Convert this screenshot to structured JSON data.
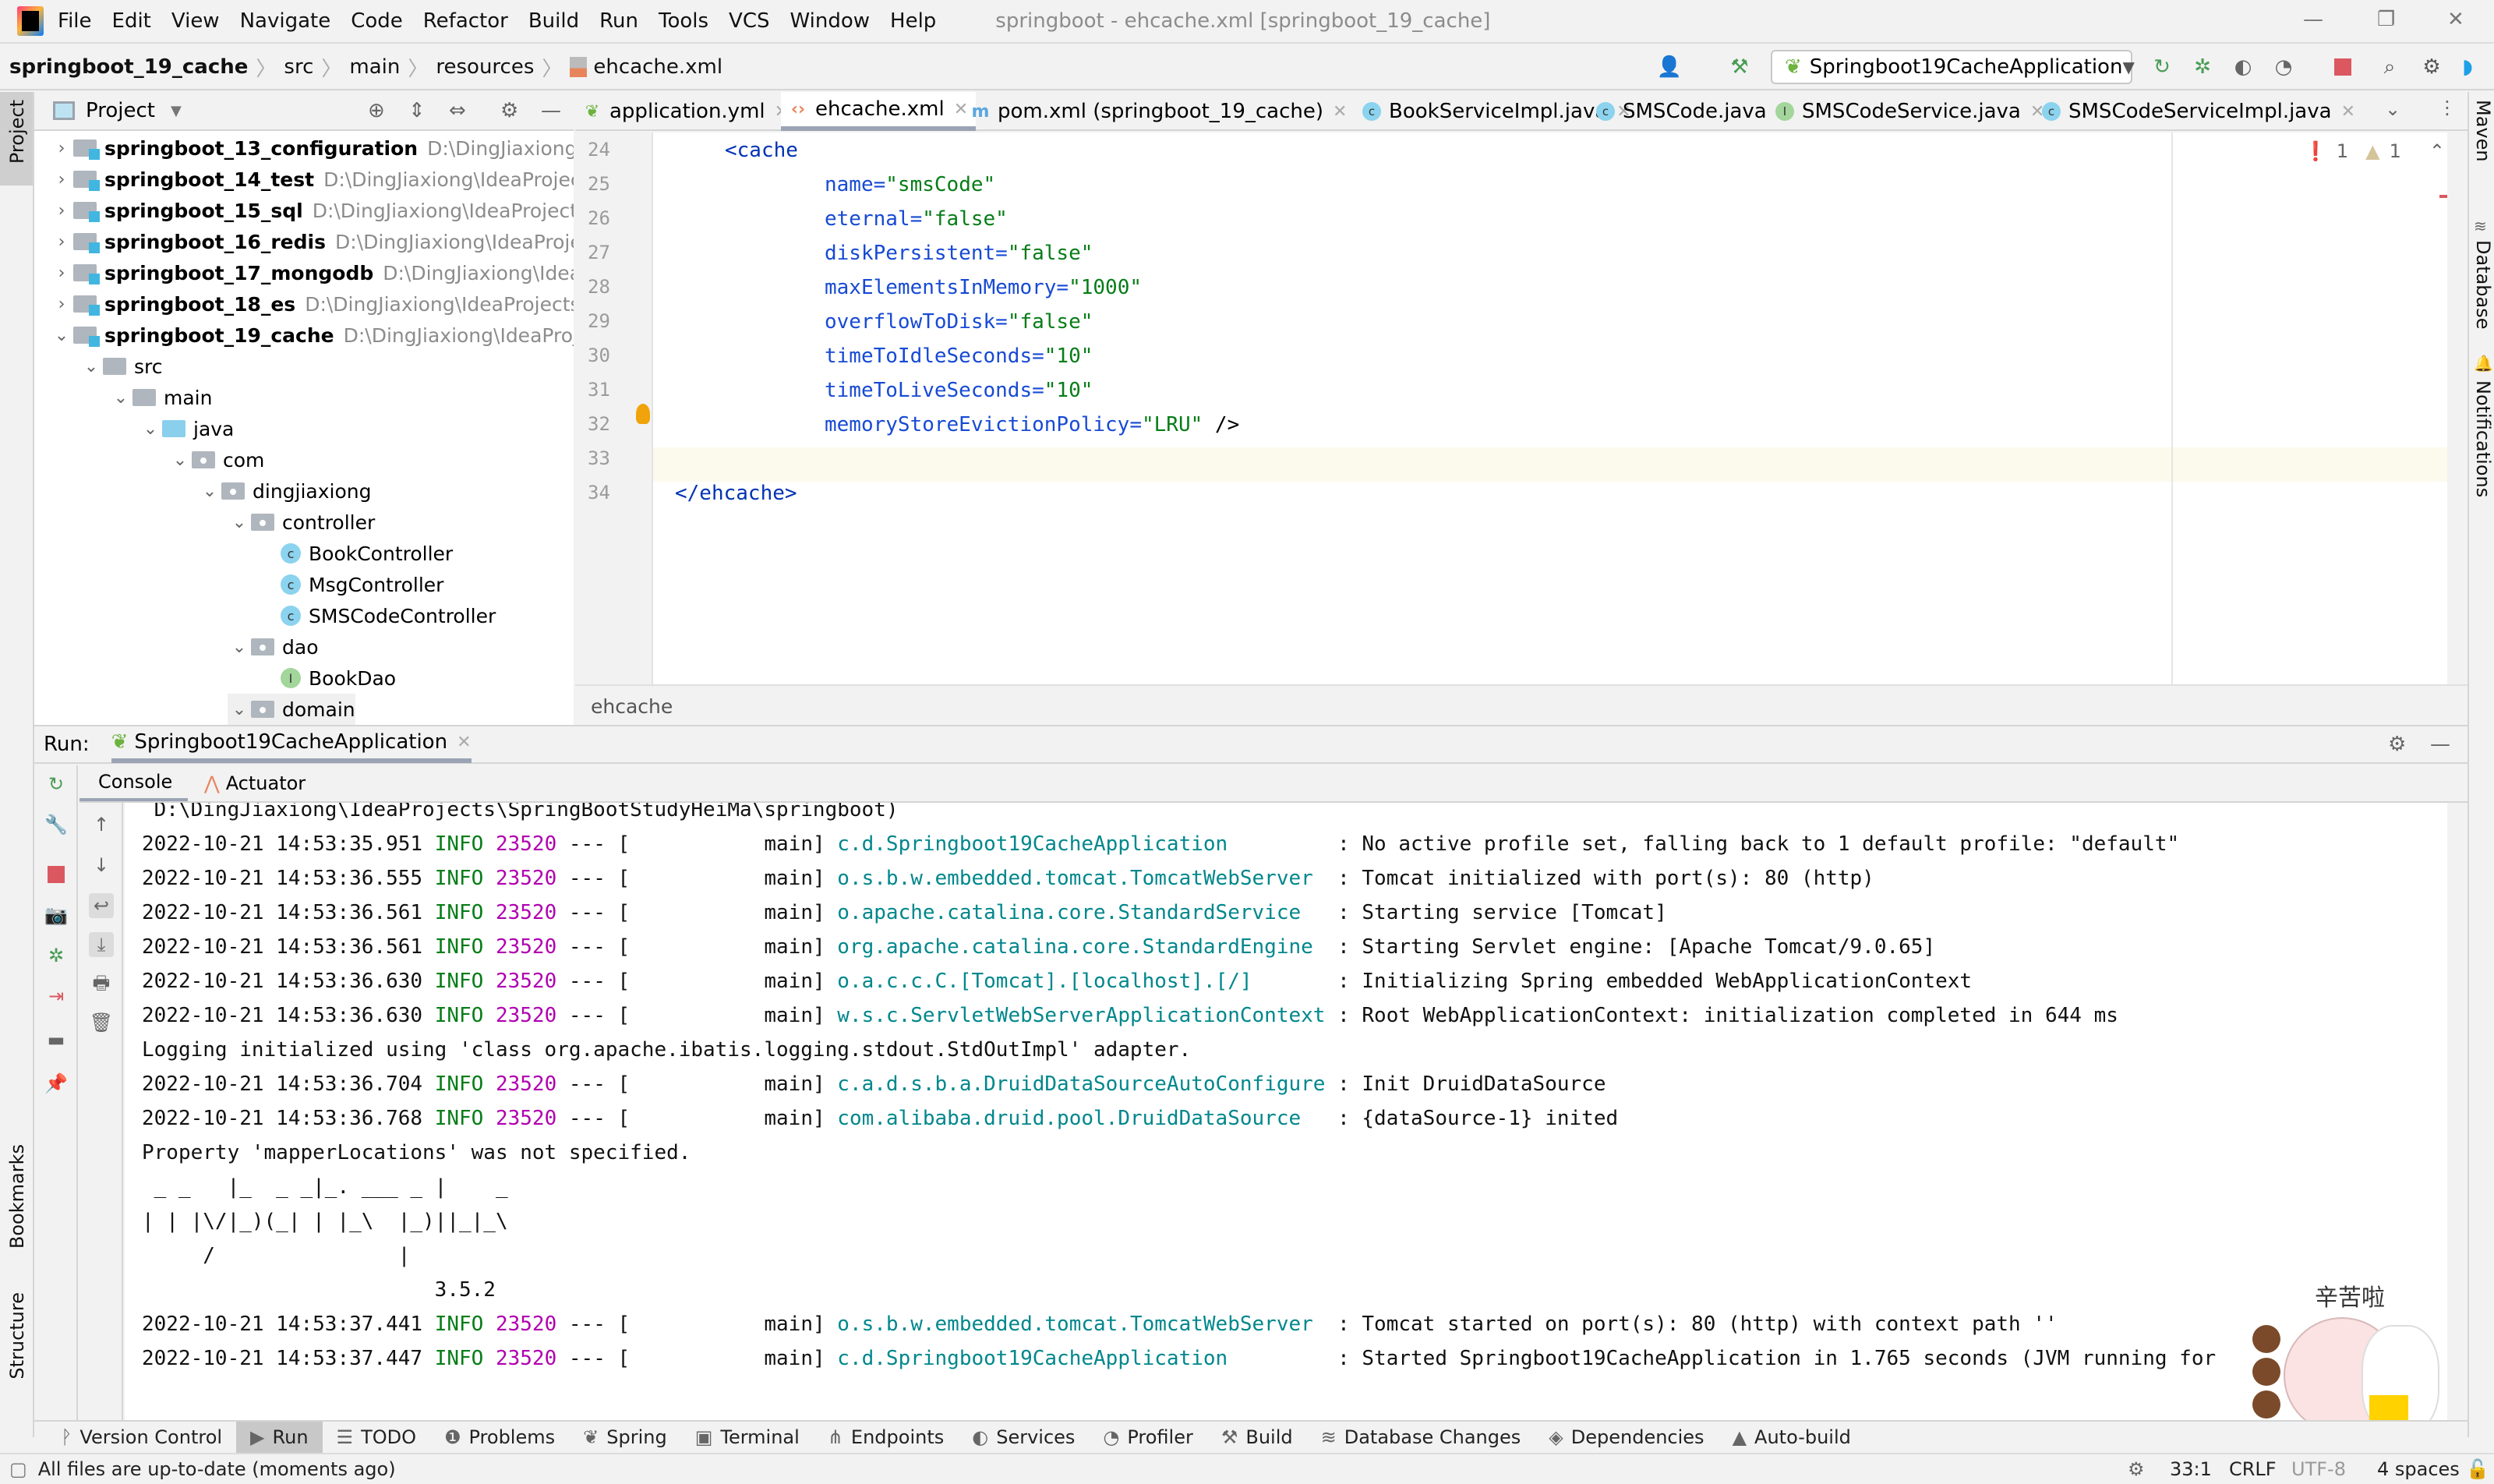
{
  "menubar": {
    "items": [
      "File",
      "Edit",
      "View",
      "Navigate",
      "Code",
      "Refactor",
      "Build",
      "Run",
      "Tools",
      "VCS",
      "Window",
      "Help"
    ],
    "window_title": "springboot - ehcache.xml [springboot_19_cache]",
    "window_controls": [
      "minimize",
      "restore",
      "close"
    ]
  },
  "navbar": {
    "breadcrumbs": [
      "springboot_19_cache",
      "src",
      "main",
      "resources",
      "ehcache.xml"
    ],
    "run_config": "Springboot19CacheApplication"
  },
  "project_panel": {
    "title": "Project",
    "tree": [
      {
        "label": "springboot_13_configuration",
        "path": "D:\\DingJiaxiong\\IdeaProjects\\SpringBootStudyHeiMa",
        "type": "module",
        "expanded": false,
        "depth": 0
      },
      {
        "label": "springboot_14_test",
        "path": "D:\\DingJiaxiong\\IdeaProjects\\SpringBootStudyHeiMa",
        "type": "module",
        "expanded": false,
        "depth": 0
      },
      {
        "label": "springboot_15_sql",
        "path": "D:\\DingJiaxiong\\IdeaProjects\\SpringBootStudyHeiMa",
        "type": "module",
        "expanded": false,
        "depth": 0
      },
      {
        "label": "springboot_16_redis",
        "path": "D:\\DingJiaxiong\\IdeaProjects\\SpringBootStudyHeiMa",
        "type": "module",
        "expanded": false,
        "depth": 0
      },
      {
        "label": "springboot_17_mongodb",
        "path": "D:\\DingJiaxiong\\IdeaProjects\\SpringBootStudyHeiMa",
        "type": "module",
        "expanded": false,
        "depth": 0
      },
      {
        "label": "springboot_18_es",
        "path": "D:\\DingJiaxiong\\IdeaProjects\\SpringBootStudyHeiMa",
        "type": "module",
        "expanded": false,
        "depth": 0
      },
      {
        "label": "springboot_19_cache",
        "path": "D:\\DingJiaxiong\\IdeaProjects\\SpringBootStudyHeiMa",
        "type": "module",
        "expanded": true,
        "depth": 0
      },
      {
        "label": "src",
        "type": "folder",
        "expanded": true,
        "depth": 1
      },
      {
        "label": "main",
        "type": "folder",
        "expanded": true,
        "depth": 2
      },
      {
        "label": "java",
        "type": "source",
        "expanded": true,
        "depth": 3
      },
      {
        "label": "com",
        "type": "package",
        "expanded": true,
        "depth": 4
      },
      {
        "label": "dingjiaxiong",
        "type": "package",
        "expanded": true,
        "depth": 5
      },
      {
        "label": "controller",
        "type": "package",
        "expanded": true,
        "depth": 6
      },
      {
        "label": "BookController",
        "type": "class",
        "depth": 7
      },
      {
        "label": "MsgController",
        "type": "class",
        "depth": 7
      },
      {
        "label": "SMSCodeController",
        "type": "class",
        "depth": 7
      },
      {
        "label": "dao",
        "type": "package",
        "expanded": true,
        "depth": 6
      },
      {
        "label": "BookDao",
        "type": "interface",
        "depth": 7
      },
      {
        "label": "domain",
        "type": "package",
        "expanded": true,
        "depth": 6
      }
    ]
  },
  "editor_tabs": [
    {
      "label": "application.yml",
      "icon": "spring-icon"
    },
    {
      "label": "ehcache.xml",
      "icon": "xml-icon",
      "active": true
    },
    {
      "label": "pom.xml (springboot_19_cache)",
      "icon": "maven-icon"
    },
    {
      "label": "BookServiceImpl.java",
      "icon": "class-icon"
    },
    {
      "label": "SMSCode.java",
      "icon": "class-icon"
    },
    {
      "label": "SMSCodeService.java",
      "icon": "interface-icon"
    },
    {
      "label": "SMSCodeServiceImpl.java",
      "icon": "class-icon"
    }
  ],
  "editor": {
    "inspections": {
      "errors": "1",
      "warnings": "1"
    },
    "lines": [
      {
        "n": "24",
        "tag": "<cache"
      },
      {
        "n": "25",
        "attr": "name=",
        "val": "\"smsCode\""
      },
      {
        "n": "26",
        "attr": "eternal=",
        "val": "\"false\""
      },
      {
        "n": "27",
        "attr": "diskPersistent=",
        "val": "\"false\""
      },
      {
        "n": "28",
        "attr": "maxElementsInMemory=",
        "val": "\"1000\""
      },
      {
        "n": "29",
        "attr": "overflowToDisk=",
        "val": "\"false\""
      },
      {
        "n": "30",
        "attr": "timeToIdleSeconds=",
        "val": "\"10\""
      },
      {
        "n": "31",
        "attr": "timeToLiveSeconds=",
        "val": "\"10\""
      },
      {
        "n": "32",
        "attr": "memoryStoreEvictionPolicy=",
        "val": "\"LRU\"",
        "tail": " />"
      },
      {
        "n": "33"
      },
      {
        "n": "34",
        "close": "</ehcache>"
      }
    ],
    "footer_breadcrumb": "ehcache"
  },
  "right_strip": [
    "Maven",
    "Database",
    "Notifications"
  ],
  "left_strip": [
    "Project",
    "Bookmarks",
    "Structure"
  ],
  "run_panel": {
    "label": "Run:",
    "config_tab": "Springboot19CacheApplication",
    "subtabs": [
      "Console",
      "Actuator"
    ],
    "console": {
      "first_line": " D:\\DingJiaxiong\\IdeaProjects\\SpringBootStudyHeiMa\\springboot)",
      "logs": [
        {
          "ts": "2022-10-21 14:53:35.951",
          "level": "INFO",
          "pid": "23520",
          "thread": "--- [           main]",
          "logger": "c.d.Springboot19CacheApplication        ",
          "msg": ": No active profile set, falling back to 1 default profile: \"default\""
        },
        {
          "ts": "2022-10-21 14:53:36.555",
          "level": "INFO",
          "pid": "23520",
          "thread": "--- [           main]",
          "logger": "o.s.b.w.embedded.tomcat.TomcatWebServer ",
          "msg": ": Tomcat initialized with port(s): 80 (http)"
        },
        {
          "ts": "2022-10-21 14:53:36.561",
          "level": "INFO",
          "pid": "23520",
          "thread": "--- [           main]",
          "logger": "o.apache.catalina.core.StandardService  ",
          "msg": ": Starting service [Tomcat]"
        },
        {
          "ts": "2022-10-21 14:53:36.561",
          "level": "INFO",
          "pid": "23520",
          "thread": "--- [           main]",
          "logger": "org.apache.catalina.core.StandardEngine ",
          "msg": ": Starting Servlet engine: [Apache Tomcat/9.0.65]"
        },
        {
          "ts": "2022-10-21 14:53:36.630",
          "level": "INFO",
          "pid": "23520",
          "thread": "--- [           main]",
          "logger": "o.a.c.c.C.[Tomcat].[localhost].[/]      ",
          "msg": ": Initializing Spring embedded WebApplicationContext"
        },
        {
          "ts": "2022-10-21 14:53:36.630",
          "level": "INFO",
          "pid": "23520",
          "thread": "--- [           main]",
          "logger": "w.s.c.ServletWebServerApplicationContext",
          "msg": ": Root WebApplicationContext: initialization completed in 644 ms"
        },
        {
          "plain": "Logging initialized using 'class org.apache.ibatis.logging.stdout.StdOutImpl' adapter."
        },
        {
          "ts": "2022-10-21 14:53:36.704",
          "level": "INFO",
          "pid": "23520",
          "thread": "--- [           main]",
          "logger": "c.a.d.s.b.a.DruidDataSourceAutoConfigure",
          "msg": ": Init DruidDataSource"
        },
        {
          "ts": "2022-10-21 14:53:36.768",
          "level": "INFO",
          "pid": "23520",
          "thread": "--- [           main]",
          "logger": "com.alibaba.druid.pool.DruidDataSource  ",
          "msg": ": {dataSource-1} inited"
        },
        {
          "plain": "Property 'mapperLocations' was not specified."
        },
        {
          "plain": " _ _   |_  _ _|_. ___ _ |    _ "
        },
        {
          "plain": "| | |\\/|_)(_| | |_\\  |_)||_|_\\ "
        },
        {
          "plain": "     /               |         "
        },
        {
          "plain": "                        3.5.2 "
        },
        {
          "ts": "2022-10-21 14:53:37.441",
          "level": "INFO",
          "pid": "23520",
          "thread": "--- [           main]",
          "logger": "o.s.b.w.embedded.tomcat.TomcatWebServer ",
          "msg": ": Tomcat started on port(s): 80 (http) with context path ''"
        },
        {
          "ts": "2022-10-21 14:53:37.447",
          "level": "INFO",
          "pid": "23520",
          "thread": "--- [           main]",
          "logger": "c.d.Springboot19CacheApplication        ",
          "msg": ": Started Springboot19CacheApplication in 1.765 seconds (JVM running for"
        }
      ]
    }
  },
  "tool_windows": [
    "Version Control",
    "Run",
    "TODO",
    "Problems",
    "Spring",
    "Terminal",
    "Endpoints",
    "Services",
    "Profiler",
    "Build",
    "Database Changes",
    "Dependencies",
    "Auto-build"
  ],
  "status_bar": {
    "message": "All files are up-to-date (moments ago)",
    "position": "33:1",
    "line_sep": "CRLF",
    "encoding": "UTF-8",
    "indent": "4 spaces"
  },
  "sticker_text": "辛苦啦",
  "colors": {
    "accent": "#087cfa",
    "stop": "#db5860",
    "run": "#499c54",
    "log_level": "#067d17",
    "pid": "#b000b0",
    "logger": "#00878c"
  }
}
